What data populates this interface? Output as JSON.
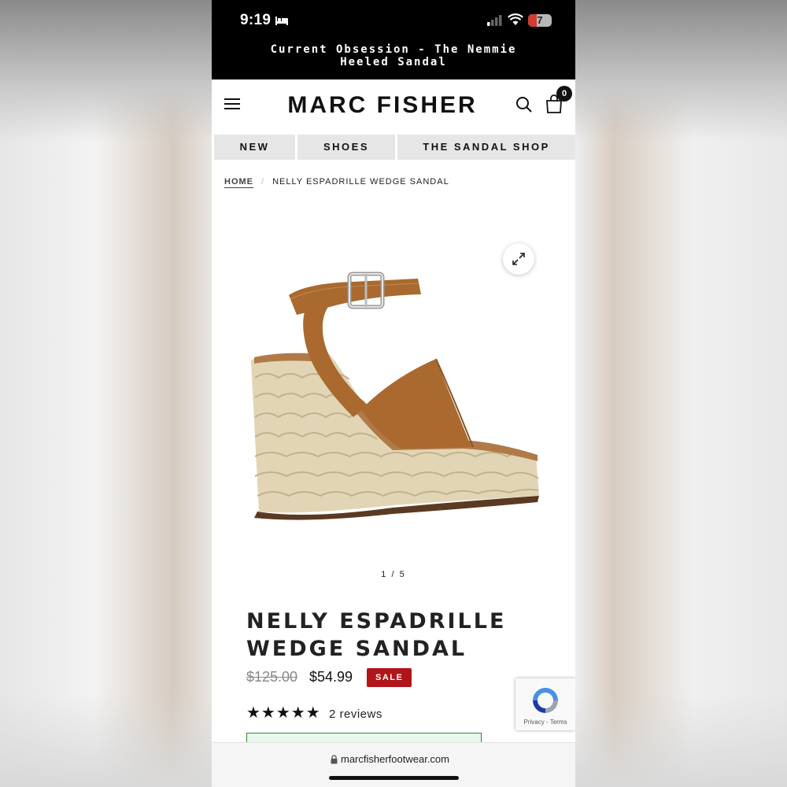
{
  "status_bar": {
    "time": "9:19",
    "battery": "7"
  },
  "promo_banner": "Current Obsession - The Nemmie Heeled Sandal",
  "header": {
    "logo": "MARC FISHER",
    "cart_count": "0"
  },
  "nav": {
    "items": [
      "NEW",
      "SHOES",
      "THE SANDAL SHOP"
    ]
  },
  "breadcrumb": {
    "home": "HOME",
    "separator": "/",
    "current": "NELLY ESPADRILLE WEDGE SANDAL"
  },
  "gallery": {
    "pager": "1 / 5"
  },
  "product": {
    "title": "NELLY ESPADRILLE WEDGE SANDAL",
    "price_original": "$125.00",
    "price_sale": "$54.99",
    "badge": "SALE",
    "stars": "★★★★★",
    "rating": 5,
    "reviews": "2 reviews"
  },
  "recaptcha": {
    "links": "Privacy - Terms"
  },
  "browser": {
    "url": "marcfisherfootwear.com"
  },
  "colors": {
    "sale_red": "#b0151a",
    "tan_suede": "#a9692f",
    "jute": "#e2d5b5"
  }
}
